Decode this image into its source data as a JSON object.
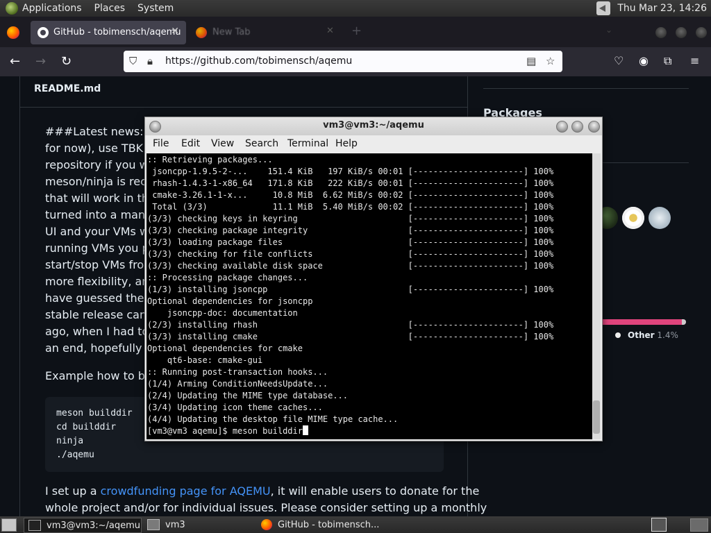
{
  "top_panel": {
    "menus": [
      "Applications",
      "Places",
      "System"
    ],
    "clock": "Thu Mar 23, 14:26"
  },
  "browser": {
    "tabs": [
      {
        "label": "GitHub - tobimensch/aqemu"
      },
      {
        "label": "New Tab"
      }
    ],
    "url": "https://github.com/tobimensch/aqemu"
  },
  "readme": {
    "title": "README.md",
    "paragraph_lines": [
      "###Latest news: 202",
      "for now), use TBK fo",
      "repository if you wan",
      "meson/ninja is recom",
      "that will work in the n",
      "turned into a manag",
      "UI and your VMs wil",
      "running VMs you pre",
      "start/stop VMs from",
      "more flexibility, and h",
      "have guessed there",
      "stable release can't",
      "ago, when I had to s",
      "an end, hopefully wit"
    ],
    "build_intro": "Example how to buil",
    "code_lines": [
      "meson builddir",
      "cd builddir",
      "ninja",
      "./aqemu"
    ],
    "crowd_prefix": "I set up a ",
    "crowd_link": "crowdfunding page for AQEMU",
    "crowd_suffix": ", it will enable users to donate for the",
    "crowd_line2": "whole project and/or for individual issues. Please consider setting up a monthly"
  },
  "sidebar": {
    "packages_heading": "Packages",
    "lang_other_label": "Other",
    "lang_other_pct": "1.4%"
  },
  "terminal": {
    "title": "vm3@vm3:~/aqemu",
    "menu": [
      "File",
      "Edit",
      "View",
      "Search",
      "Terminal",
      "Help"
    ],
    "lines": [
      ":: Retrieving packages...",
      " jsoncpp-1.9.5-2-...    151.4 KiB   197 KiB/s 00:01 [----------------------] 100%",
      " rhash-1.4.3-1-x86_64   171.8 KiB   222 KiB/s 00:01 [----------------------] 100%",
      " cmake-3.26.1-1-x...     10.8 MiB  6.62 MiB/s 00:02 [----------------------] 100%",
      " Total (3/3)             11.1 MiB  5.40 MiB/s 00:02 [----------------------] 100%",
      "(3/3) checking keys in keyring                      [----------------------] 100%",
      "(3/3) checking package integrity                    [----------------------] 100%",
      "(3/3) loading package files                         [----------------------] 100%",
      "(3/3) checking for file conflicts                   [----------------------] 100%",
      "(3/3) checking available disk space                 [----------------------] 100%",
      ":: Processing package changes...",
      "(1/3) installing jsoncpp                            [----------------------] 100%",
      "Optional dependencies for jsoncpp",
      "    jsoncpp-doc: documentation",
      "(2/3) installing rhash                              [----------------------] 100%",
      "(3/3) installing cmake                              [----------------------] 100%",
      "Optional dependencies for cmake",
      "    qt6-base: cmake-gui",
      ":: Running post-transaction hooks...",
      "(1/4) Arming ConditionNeedsUpdate...",
      "(2/4) Updating the MIME type database...",
      "(3/4) Updating icon theme caches...",
      "(4/4) Updating the desktop file MIME type cache..."
    ],
    "prompt": "[vm3@vm3 aqemu]$ meson builddir"
  },
  "taskbar": {
    "items": [
      "vm3@vm3:~/aqemu",
      "vm3",
      "GitHub - tobimensch..."
    ]
  }
}
